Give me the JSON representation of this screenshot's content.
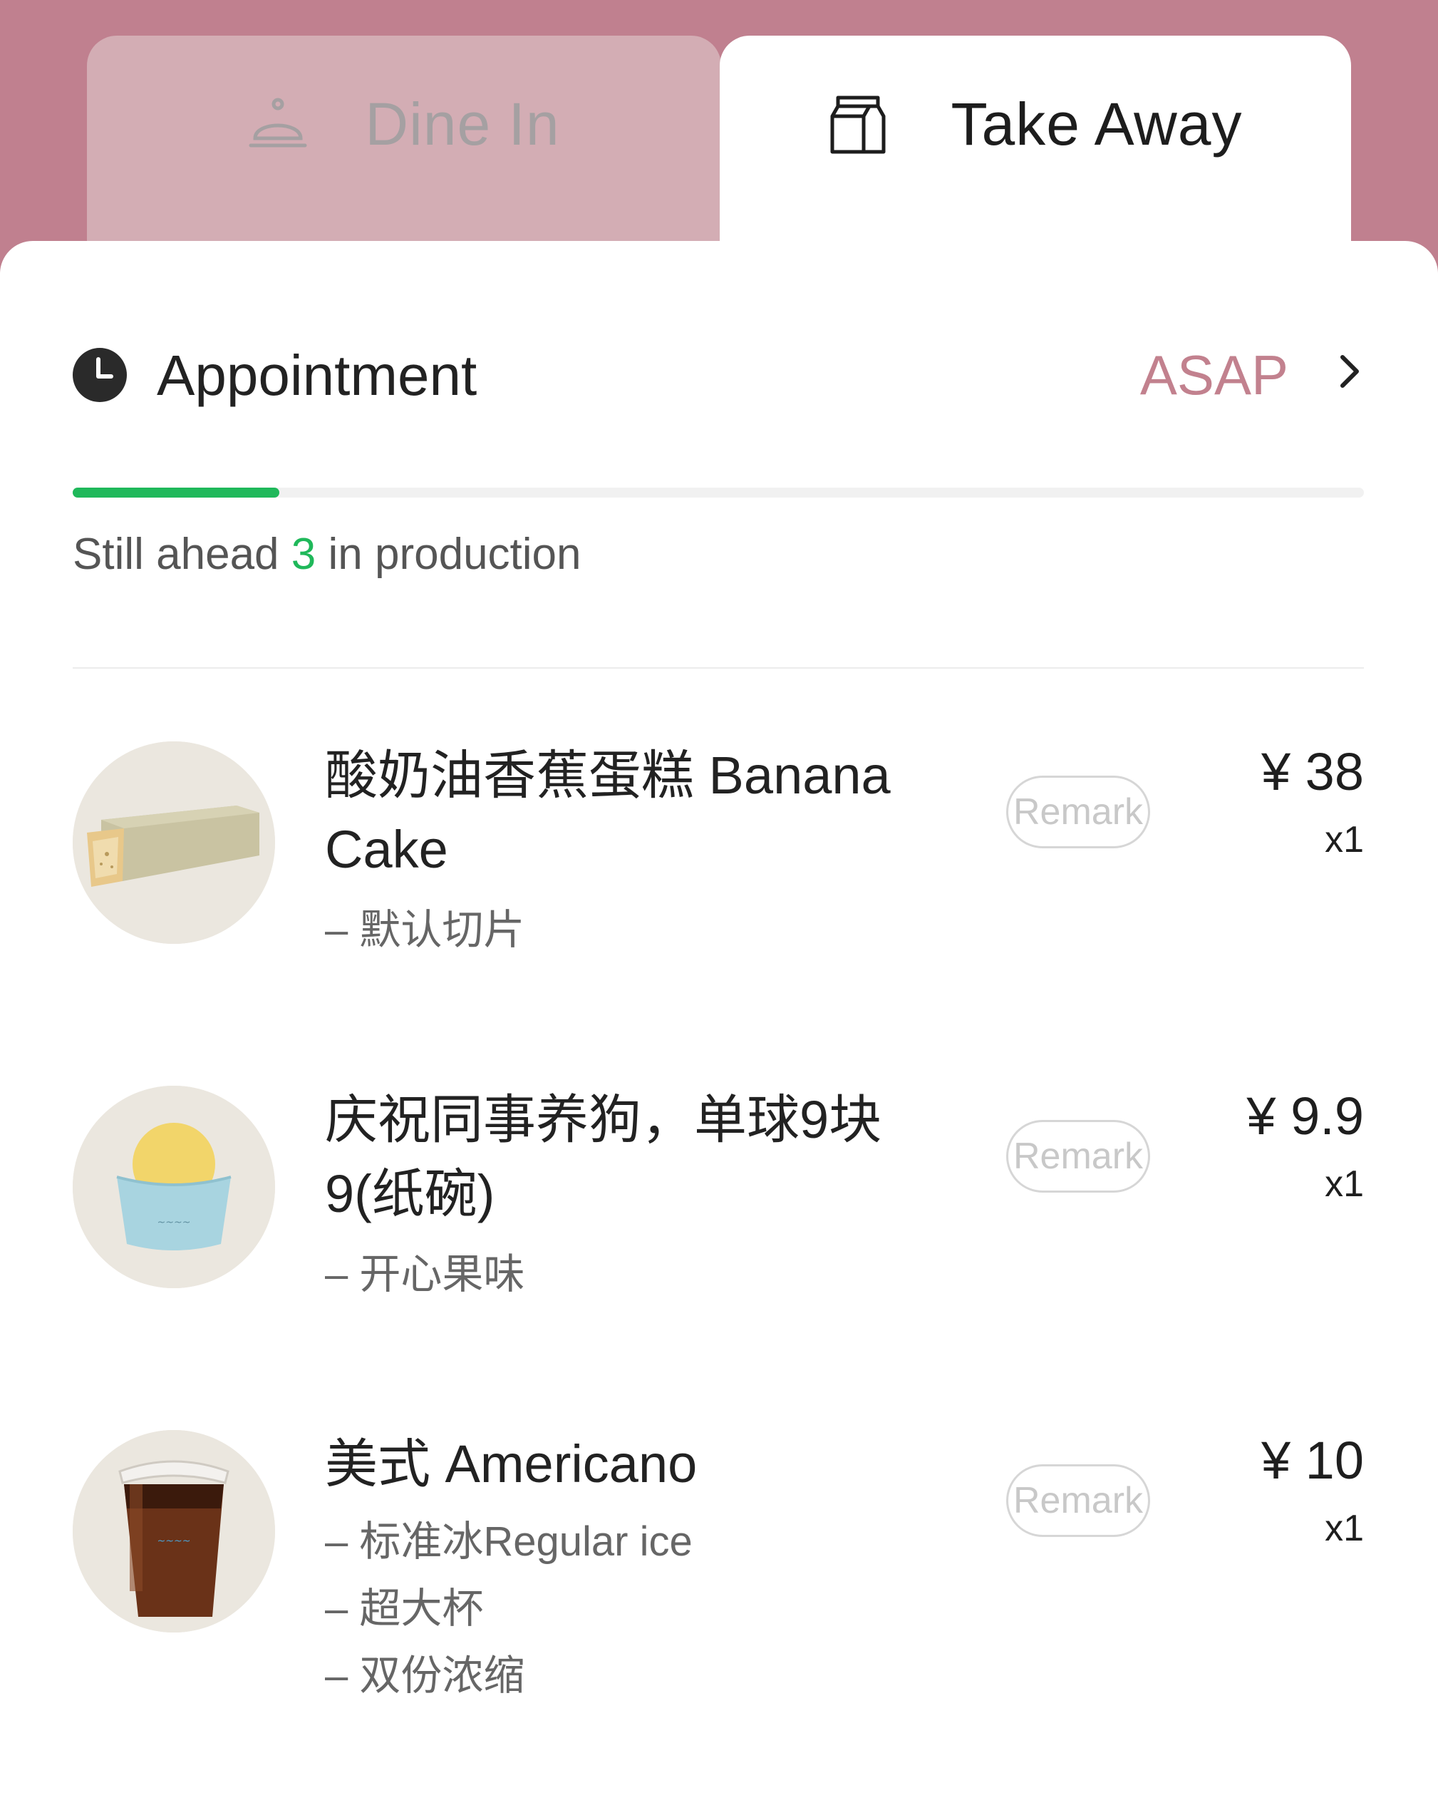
{
  "tabs": {
    "dine_in": {
      "label": "Dine In",
      "icon": "service-bell-icon",
      "active": false
    },
    "take_away": {
      "label": "Take Away",
      "icon": "milk-carton-icon",
      "active": true
    }
  },
  "appointment": {
    "title": "Appointment",
    "icon": "clock-icon",
    "value": "ASAP",
    "chevron": "chevron-right-icon"
  },
  "progress": {
    "fraction": 0.16
  },
  "queue": {
    "prefix": "Still ahead",
    "count": "3",
    "suffix": "in production"
  },
  "items": [
    {
      "name": "酸奶油香蕉蛋糕 Banana Cake",
      "options": [
        "– 默认切片"
      ],
      "remark": "Remark",
      "price": "¥ 38",
      "qty": "x1",
      "image_icon": "banana-cake-image"
    },
    {
      "name": "庆祝同事养狗，单球9块9(纸碗)",
      "options": [
        "– 开心果味"
      ],
      "remark": "Remark",
      "price": "¥ 9.9",
      "qty": "x1",
      "image_icon": "ice-cream-cup-image"
    },
    {
      "name": "美式 Americano",
      "options": [
        "– 标准冰Regular ice",
        "– 超大杯",
        "– 双份浓缩"
      ],
      "remark": "Remark",
      "price": "¥ 10",
      "qty": "x1",
      "image_icon": "iced-coffee-image"
    }
  ],
  "colors": {
    "brand": "#c0808f",
    "accent_green": "#1fb85a",
    "asap": "#c2818e"
  }
}
